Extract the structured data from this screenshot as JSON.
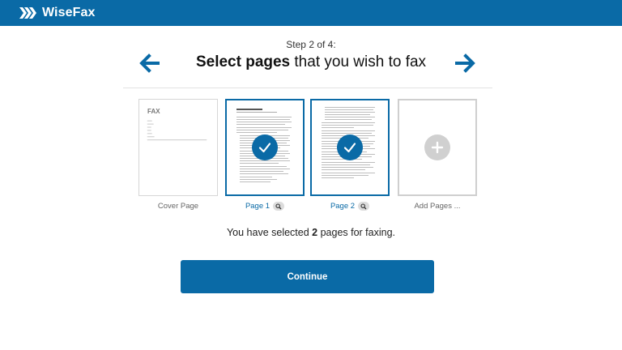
{
  "app": {
    "name": "WiseFax"
  },
  "wizard": {
    "step_text": "Step 2 of 4:",
    "title_bold": "Select pages",
    "title_rest": " that you wish to fax"
  },
  "pages": [
    {
      "label": "Cover Page",
      "selected": false,
      "cover_heading": "FAX"
    },
    {
      "label": "Page 1",
      "selected": true
    },
    {
      "label": "Page 2",
      "selected": true
    },
    {
      "label": "Add Pages ..."
    }
  ],
  "summary": {
    "prefix": "You have selected ",
    "count": "2",
    "suffix": " pages for faxing."
  },
  "actions": {
    "continue_label": "Continue"
  },
  "colors": {
    "brand": "#0a6aa6",
    "page_bg": "#ffffff",
    "muted": "#d0d0d0"
  },
  "icons": {
    "logo": "wisefax-chevrons-icon",
    "prev": "arrow-left-icon",
    "next": "arrow-right-icon",
    "selected": "checkmark-icon",
    "zoom": "magnifier-icon",
    "add": "plus-icon"
  }
}
